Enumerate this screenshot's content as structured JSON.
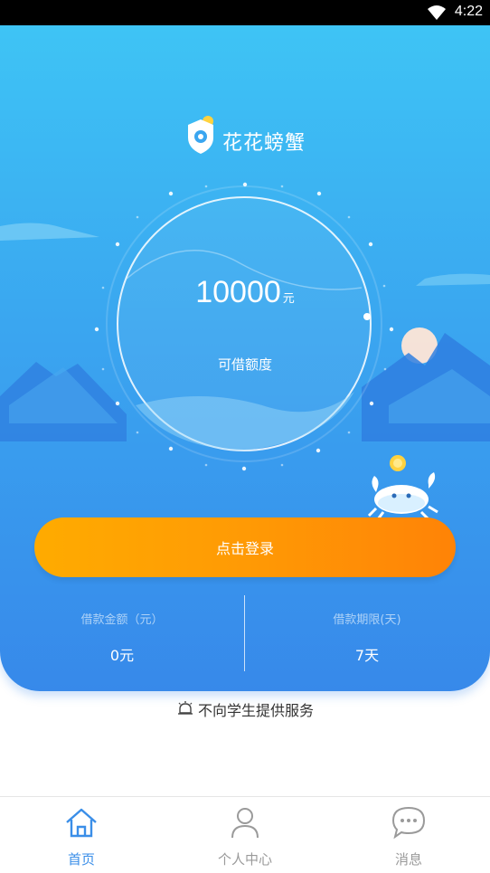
{
  "status_bar": {
    "time": "4:22"
  },
  "brand": {
    "name": "花花螃蟹"
  },
  "credit": {
    "amount": "10000",
    "unit": "元",
    "label": "可借额度"
  },
  "login_button": {
    "label": "点击登录"
  },
  "stats": {
    "loan_amount": {
      "label": "借款金额（元）",
      "value": "0元"
    },
    "loan_term": {
      "label": "借款期限(天)",
      "value": "7天"
    }
  },
  "notice": {
    "text": "不向学生提供服务"
  },
  "tabbar": {
    "active_color": "#3a8ee8",
    "inactive_color": "#9a9a9a",
    "items": [
      {
        "label": "首页",
        "icon": "home-icon",
        "active": true
      },
      {
        "label": "个人中心",
        "icon": "user-icon",
        "active": false
      },
      {
        "label": "消息",
        "icon": "message-icon",
        "active": false
      }
    ]
  },
  "colors": {
    "hero_top": "#3ec4f5",
    "hero_bottom": "#3789ea",
    "button_start": "#ffab00",
    "button_end": "#ff8306"
  }
}
